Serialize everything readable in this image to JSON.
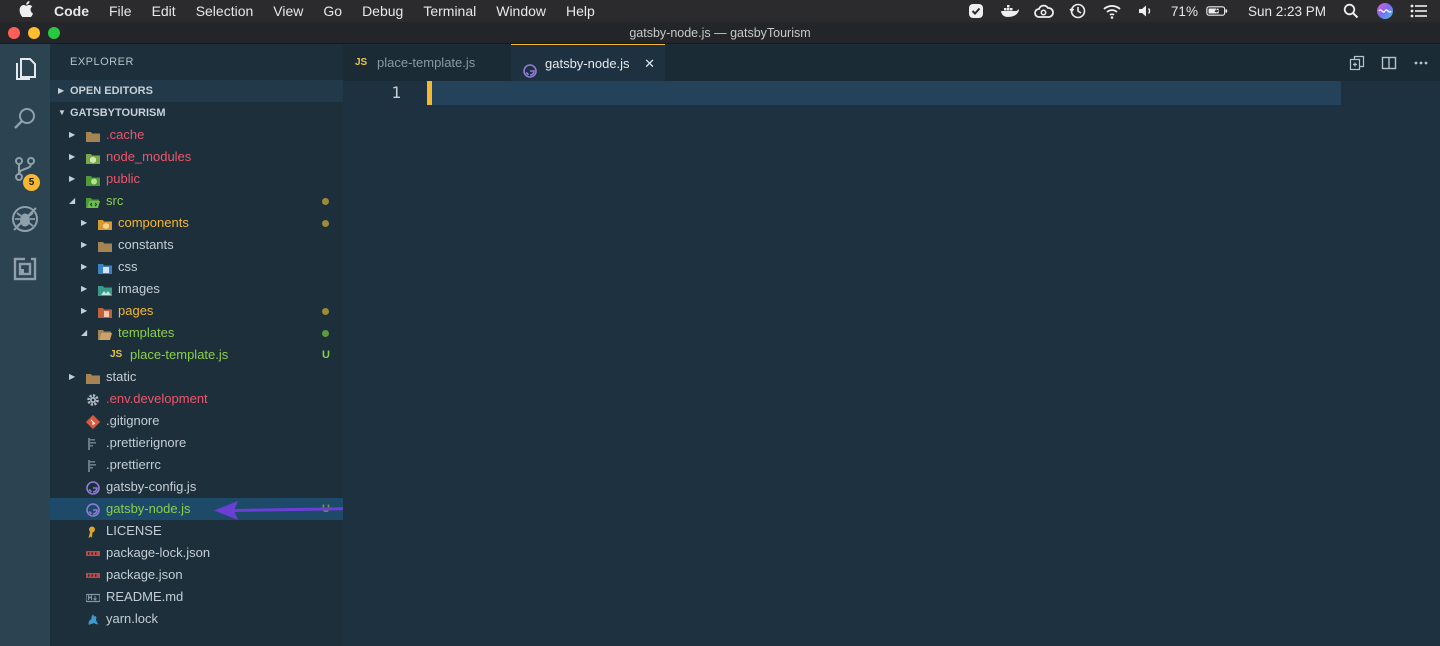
{
  "menubar": {
    "app": "Code",
    "items": [
      "File",
      "Edit",
      "Selection",
      "View",
      "Go",
      "Debug",
      "Terminal",
      "Window",
      "Help"
    ],
    "battery": "71%",
    "clock": "Sun 2:23 PM"
  },
  "window": {
    "title": "gatsby-node.js — gatsbyTourism"
  },
  "activity": {
    "scm_badge": "5"
  },
  "sidebar": {
    "header": "EXPLORER",
    "open_editors": "OPEN EDITORS",
    "project": "GATSBYTOURISM",
    "items": [
      {
        "label": ".cache",
        "color": "#f0556b"
      },
      {
        "label": "node_modules",
        "color": "#f0556b"
      },
      {
        "label": "public",
        "color": "#f0556b"
      },
      {
        "label": "src",
        "color": "#8ccf4a"
      },
      {
        "label": "components",
        "color": "#f5b833"
      },
      {
        "label": "constants",
        "color": "#c5ced5"
      },
      {
        "label": "css",
        "color": "#c5ced5"
      },
      {
        "label": "images",
        "color": "#c5ced5"
      },
      {
        "label": "pages",
        "color": "#f5b833"
      },
      {
        "label": "templates",
        "color": "#8ccf4a"
      },
      {
        "label": "place-template.js",
        "color": "#8ccf4a",
        "status": "U"
      },
      {
        "label": "static",
        "color": "#c5ced5"
      },
      {
        "label": ".env.development",
        "color": "#f0556b"
      },
      {
        "label": ".gitignore",
        "color": "#c5ced5"
      },
      {
        "label": ".prettierignore",
        "color": "#c5ced5"
      },
      {
        "label": ".prettierrc",
        "color": "#c5ced5"
      },
      {
        "label": "gatsby-config.js",
        "color": "#c5ced5"
      },
      {
        "label": "gatsby-node.js",
        "color": "#8ccf4a",
        "status": "U"
      },
      {
        "label": "LICENSE",
        "color": "#c5ced5"
      },
      {
        "label": "package-lock.json",
        "color": "#c5ced5"
      },
      {
        "label": "package.json",
        "color": "#c5ced5"
      },
      {
        "label": "README.md",
        "color": "#c5ced5"
      },
      {
        "label": "yarn.lock",
        "color": "#c5ced5"
      }
    ]
  },
  "tabs": [
    {
      "label": "place-template.js",
      "icon": "JS"
    },
    {
      "label": "gatsby-node.js",
      "icon": "gatsby-icon",
      "close": "✕"
    }
  ],
  "editor": {
    "line_number": "1"
  },
  "colors": {
    "accent": "#f5b833",
    "modified_dot": "#9a8a3c",
    "added_dot": "#5a9a3c",
    "arrow": "#6b3fd4"
  }
}
